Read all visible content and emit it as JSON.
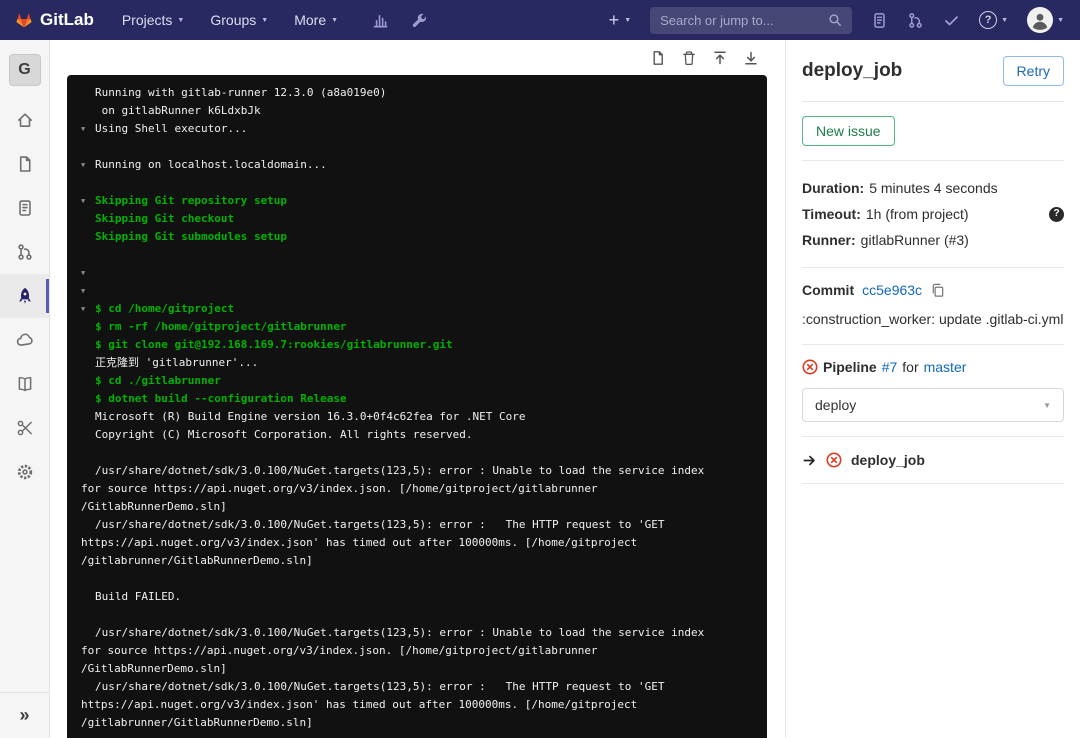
{
  "navbar": {
    "brand": "GitLab",
    "menus": [
      {
        "label": "Projects"
      },
      {
        "label": "Groups"
      },
      {
        "label": "More"
      }
    ],
    "plus_label": "+",
    "search": {
      "placeholder": "Search or jump to...",
      "value": ""
    },
    "icons": [
      "tanuki-logo",
      "bar-chart-icon",
      "wrench-icon",
      "plus-icon",
      "search-icon",
      "issues-icon",
      "merge-requests-icon",
      "todos-check-icon",
      "help-icon",
      "user-avatar",
      "chevron-down-icon"
    ]
  },
  "sidebar": {
    "project_initial": "G",
    "items": [
      {
        "name": "project-overview",
        "icon": "home-icon",
        "active": false
      },
      {
        "name": "repository",
        "icon": "document-icon",
        "active": false
      },
      {
        "name": "issues",
        "icon": "issues-icon",
        "active": false
      },
      {
        "name": "merge-requests",
        "icon": "merge-request-icon",
        "active": false
      },
      {
        "name": "ci-cd",
        "icon": "rocket-icon",
        "active": true
      },
      {
        "name": "operations",
        "icon": "cloud-icon",
        "active": false
      },
      {
        "name": "wiki",
        "icon": "book-icon",
        "active": false
      },
      {
        "name": "snippets",
        "icon": "scissors-icon",
        "active": false
      },
      {
        "name": "settings",
        "icon": "gear-icon",
        "active": false
      }
    ],
    "collapse_label": "»"
  },
  "log": {
    "toolbar_icons": [
      "raw-file-icon",
      "erase-log-icon",
      "scroll-to-top-icon",
      "scroll-to-bottom-icon"
    ],
    "lines": [
      {
        "cls": "out",
        "text": "Running with gitlab-runner 12.3.0 (a8a019e0)"
      },
      {
        "cls": "out",
        "text": " on gitlabRunner k6LdxbJk"
      },
      {
        "arrow": true,
        "cls": "out",
        "text": "Using Shell executor..."
      },
      {
        "cls": "out",
        "text": ""
      },
      {
        "arrow": true,
        "cls": "out",
        "text": "Running on localhost.localdomain..."
      },
      {
        "cls": "out",
        "text": ""
      },
      {
        "arrow": true,
        "cls": "cmd",
        "text": "Skipping Git repository setup"
      },
      {
        "cls": "cmd",
        "text": "Skipping Git checkout"
      },
      {
        "cls": "cmd",
        "text": "Skipping Git submodules setup"
      },
      {
        "cls": "out",
        "text": ""
      },
      {
        "arrow": true,
        "cls": "out",
        "text": ""
      },
      {
        "arrow": true,
        "cls": "out",
        "text": ""
      },
      {
        "arrow": true,
        "cls": "cmd",
        "text": "$ cd /home/gitproject"
      },
      {
        "cls": "cmd",
        "text": "$ rm -rf /home/gitproject/gitlabrunner"
      },
      {
        "cls": "cmd",
        "text": "$ git clone git@192.168.169.7:rookies/gitlabrunner.git"
      },
      {
        "cls": "out",
        "text": "正克隆到 'gitlabrunner'..."
      },
      {
        "cls": "cmd",
        "text": "$ cd ./gitlabrunner"
      },
      {
        "cls": "cmd",
        "text": "$ dotnet build --configuration Release"
      },
      {
        "cls": "out",
        "text": "Microsoft (R) Build Engine version 16.3.0+0f4c62fea for .NET Core"
      },
      {
        "cls": "out",
        "text": "Copyright (C) Microsoft Corporation. All rights reserved."
      },
      {
        "cls": "out",
        "text": ""
      },
      {
        "cls": "out",
        "text": "/usr/share/dotnet/sdk/3.0.100/NuGet.targets(123,5): error : Unable to load the service index"
      },
      {
        "flush": true,
        "cls": "out",
        "text": "for source https://api.nuget.org/v3/index.json. [/home/gitproject/gitlabrunner"
      },
      {
        "flush": true,
        "cls": "out",
        "text": "/GitlabRunnerDemo.sln]"
      },
      {
        "cls": "out",
        "text": "/usr/share/dotnet/sdk/3.0.100/NuGet.targets(123,5): error :   The HTTP request to 'GET"
      },
      {
        "flush": true,
        "cls": "out",
        "text": "https://api.nuget.org/v3/index.json' has timed out after 100000ms. [/home/gitproject"
      },
      {
        "flush": true,
        "cls": "out",
        "text": "/gitlabrunner/GitlabRunnerDemo.sln]"
      },
      {
        "cls": "out",
        "text": ""
      },
      {
        "cls": "out",
        "text": "Build FAILED."
      },
      {
        "cls": "out",
        "text": ""
      },
      {
        "cls": "out",
        "text": "/usr/share/dotnet/sdk/3.0.100/NuGet.targets(123,5): error : Unable to load the service index"
      },
      {
        "flush": true,
        "cls": "out",
        "text": "for source https://api.nuget.org/v3/index.json. [/home/gitproject/gitlabrunner"
      },
      {
        "flush": true,
        "cls": "out",
        "text": "/GitlabRunnerDemo.sln]"
      },
      {
        "cls": "out",
        "text": "/usr/share/dotnet/sdk/3.0.100/NuGet.targets(123,5): error :   The HTTP request to 'GET"
      },
      {
        "flush": true,
        "cls": "out",
        "text": "https://api.nuget.org/v3/index.json' has timed out after 100000ms. [/home/gitproject"
      },
      {
        "flush": true,
        "cls": "out",
        "text": "/gitlabrunner/GitlabRunnerDemo.sln]"
      }
    ]
  },
  "job": {
    "title": "deploy_job",
    "retry_label": "Retry",
    "new_issue_label": "New issue",
    "details": {
      "duration_label": "Duration:",
      "duration_value": "5 minutes 4 seconds",
      "timeout_label": "Timeout:",
      "timeout_value": "1h (from project)",
      "timeout_help": "?",
      "runner_label": "Runner:",
      "runner_value": "gitlabRunner (#3)"
    },
    "commit": {
      "label": "Commit",
      "sha": "cc5e963c",
      "message": ":construction_worker: update .gitlab-ci.yml"
    },
    "pipeline": {
      "label": "Pipeline",
      "number": "#7",
      "for_text": "for",
      "branch": "master",
      "status": "failed",
      "stage_dropdown_value": "deploy"
    },
    "jobs": [
      {
        "name": "deploy_job",
        "status": "failed",
        "current": true
      }
    ]
  },
  "colors": {
    "navbar_bg": "#292961",
    "command_green": "#00b300",
    "link_blue": "#1068bf",
    "failed_red": "#db3b21",
    "log_bg": "#111111"
  }
}
